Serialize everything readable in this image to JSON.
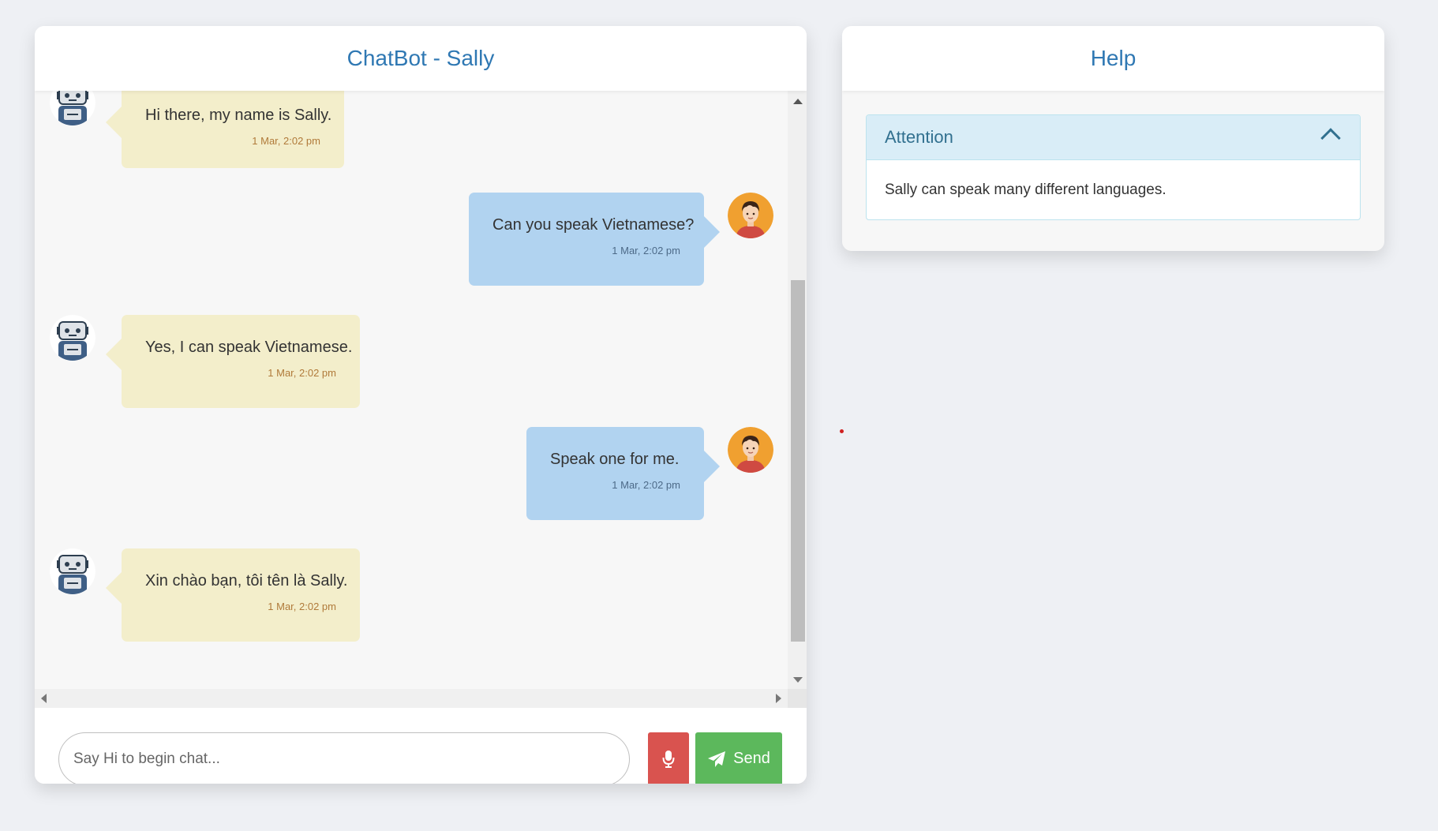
{
  "chat": {
    "title": "ChatBot - Sally",
    "messages": [
      {
        "sender": "bot",
        "text": "Hi there, my name is Sally.",
        "time": "1 Mar, 2:02 pm"
      },
      {
        "sender": "user",
        "text": "Can you speak Vietnamese?",
        "time": "1 Mar, 2:02 pm"
      },
      {
        "sender": "bot",
        "text": "Yes, I can speak Vietnamese.",
        "time": "1 Mar, 2:02 pm"
      },
      {
        "sender": "user",
        "text": "Speak one for me.",
        "time": "1 Mar, 2:02 pm"
      },
      {
        "sender": "bot",
        "text": "Xin chào bạn, tôi tên là Sally.",
        "time": "1 Mar, 2:02 pm"
      }
    ],
    "input": {
      "placeholder": "Say Hi to begin chat...",
      "value": ""
    },
    "mic_icon": "microphone-icon",
    "send": {
      "label": "Send",
      "icon": "paper-plane-icon"
    }
  },
  "help": {
    "title": "Help",
    "panel": {
      "heading": "Attention",
      "icon": "chevron-up-icon",
      "body": "Sally can speak many different languages."
    }
  },
  "colors": {
    "page_bg": "#eef0f4",
    "header_text": "#2f78b3",
    "bot_bubble": "#f3eecb",
    "user_bubble": "#b1d3f0",
    "mic_button": "#d9534f",
    "send_button": "#5cb85c",
    "panel_heading_bg": "#d9edf7"
  }
}
